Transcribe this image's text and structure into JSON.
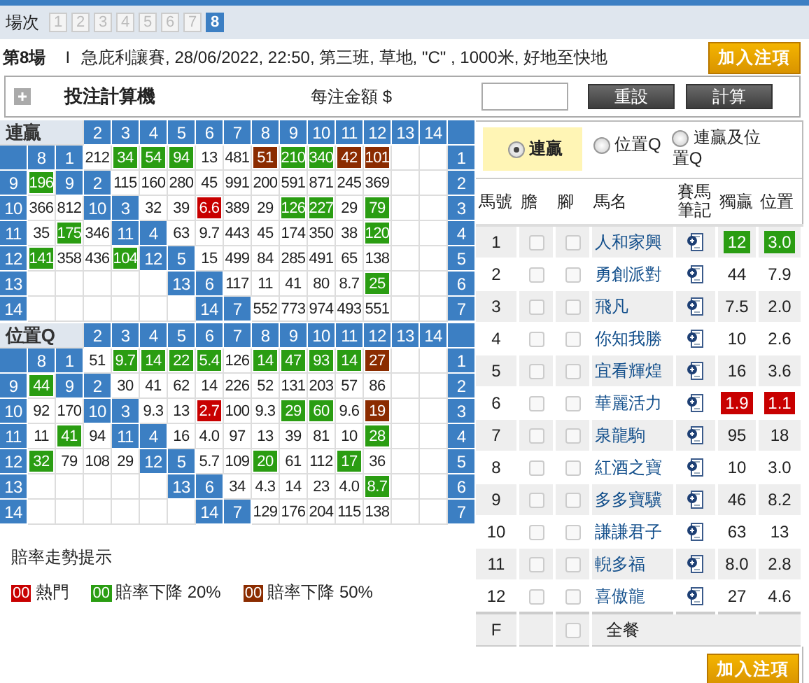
{
  "race_tabs": {
    "label": "場次",
    "items": [
      {
        "label": "1",
        "selected": false
      },
      {
        "label": "2",
        "selected": false
      },
      {
        "label": "3",
        "selected": false
      },
      {
        "label": "4",
        "selected": false
      },
      {
        "label": "5",
        "selected": false
      },
      {
        "label": "6",
        "selected": false
      },
      {
        "label": "7",
        "selected": false
      },
      {
        "label": "8",
        "selected": true
      }
    ]
  },
  "race_info": {
    "number": "第8場",
    "separator": "I",
    "details": "急庇利讓賽, 28/06/2022, 22:50, 第三班, 草地, \"C\" , 1000米, 好地至快地",
    "button": "加入注項"
  },
  "calculator": {
    "title": "投注計算機",
    "expanded": false,
    "amount_label": "每注金額 $",
    "buttons": [
      "重設",
      "計算"
    ]
  },
  "grids": [
    {
      "rows": [
        [
          {
            "text": "連贏",
            "kind": "title"
          },
          {
            "kind": "title"
          },
          {
            "kind": "title"
          },
          {
            "text": "2",
            "kind": "head"
          },
          {
            "text": "3",
            "kind": "head"
          },
          {
            "text": "4",
            "kind": "head"
          },
          {
            "text": "5",
            "kind": "head"
          },
          {
            "text": "6",
            "kind": "head"
          },
          {
            "text": "7",
            "kind": "head"
          },
          {
            "text": "8",
            "kind": "head"
          },
          {
            "text": "9",
            "kind": "head"
          },
          {
            "text": "10",
            "kind": "head"
          },
          {
            "text": "11",
            "kind": "head"
          },
          {
            "text": "12",
            "kind": "head"
          },
          {
            "text": "13",
            "kind": "head"
          },
          {
            "text": "14",
            "kind": "head"
          },
          {
            "kind": "head"
          }
        ],
        [
          {
            "kind": "head"
          },
          {
            "text": "8",
            "kind": "head"
          },
          {
            "text": "1",
            "kind": "head"
          },
          {
            "text": "212",
            "kind": "odds"
          },
          {
            "text": "34",
            "kind": "drop20"
          },
          {
            "text": "54",
            "kind": "drop20"
          },
          {
            "text": "94",
            "kind": "drop20"
          },
          {
            "text": "13",
            "kind": "odds"
          },
          {
            "text": "481",
            "kind": "odds"
          },
          {
            "text": "51",
            "kind": "drop50"
          },
          {
            "text": "210",
            "kind": "drop20"
          },
          {
            "text": "340",
            "kind": "drop20"
          },
          {
            "text": "42",
            "kind": "drop50"
          },
          {
            "text": "101",
            "kind": "drop50"
          },
          {
            "kind": "empty"
          },
          {
            "kind": "empty"
          },
          {
            "text": "1",
            "kind": "head"
          }
        ],
        [
          {
            "text": "9",
            "kind": "head"
          },
          {
            "text": "196",
            "kind": "drop20"
          },
          {
            "text": "9",
            "kind": "head"
          },
          {
            "text": "2",
            "kind": "head"
          },
          {
            "text": "115",
            "kind": "odds"
          },
          {
            "text": "160",
            "kind": "odds"
          },
          {
            "text": "280",
            "kind": "odds"
          },
          {
            "text": "45",
            "kind": "odds"
          },
          {
            "text": "991",
            "kind": "odds"
          },
          {
            "text": "200",
            "kind": "odds"
          },
          {
            "text": "591",
            "kind": "odds"
          },
          {
            "text": "871",
            "kind": "odds"
          },
          {
            "text": "245",
            "kind": "odds"
          },
          {
            "text": "369",
            "kind": "odds"
          },
          {
            "kind": "empty"
          },
          {
            "kind": "empty"
          },
          {
            "text": "2",
            "kind": "head"
          }
        ],
        [
          {
            "text": "10",
            "kind": "head"
          },
          {
            "text": "366",
            "kind": "odds"
          },
          {
            "text": "812",
            "kind": "odds"
          },
          {
            "text": "10",
            "kind": "head"
          },
          {
            "text": "3",
            "kind": "head"
          },
          {
            "text": "32",
            "kind": "odds"
          },
          {
            "text": "39",
            "kind": "odds"
          },
          {
            "text": "6.6",
            "kind": "hot"
          },
          {
            "text": "389",
            "kind": "odds"
          },
          {
            "text": "29",
            "kind": "odds"
          },
          {
            "text": "126",
            "kind": "drop20"
          },
          {
            "text": "227",
            "kind": "drop20"
          },
          {
            "text": "29",
            "kind": "odds"
          },
          {
            "text": "79",
            "kind": "drop20"
          },
          {
            "kind": "empty"
          },
          {
            "kind": "empty"
          },
          {
            "text": "3",
            "kind": "head"
          }
        ],
        [
          {
            "text": "11",
            "kind": "head"
          },
          {
            "text": "35",
            "kind": "odds"
          },
          {
            "text": "175",
            "kind": "drop20"
          },
          {
            "text": "346",
            "kind": "odds"
          },
          {
            "text": "11",
            "kind": "head"
          },
          {
            "text": "4",
            "kind": "head"
          },
          {
            "text": "63",
            "kind": "odds"
          },
          {
            "text": "9.7",
            "kind": "odds"
          },
          {
            "text": "443",
            "kind": "odds"
          },
          {
            "text": "45",
            "kind": "odds"
          },
          {
            "text": "174",
            "kind": "odds"
          },
          {
            "text": "350",
            "kind": "odds"
          },
          {
            "text": "38",
            "kind": "odds"
          },
          {
            "text": "120",
            "kind": "drop20"
          },
          {
            "kind": "empty"
          },
          {
            "kind": "empty"
          },
          {
            "text": "4",
            "kind": "head"
          }
        ],
        [
          {
            "text": "12",
            "kind": "head"
          },
          {
            "text": "141",
            "kind": "drop20"
          },
          {
            "text": "358",
            "kind": "odds"
          },
          {
            "text": "436",
            "kind": "odds"
          },
          {
            "text": "104",
            "kind": "drop20"
          },
          {
            "text": "12",
            "kind": "head"
          },
          {
            "text": "5",
            "kind": "head"
          },
          {
            "text": "15",
            "kind": "odds"
          },
          {
            "text": "499",
            "kind": "odds"
          },
          {
            "text": "84",
            "kind": "odds"
          },
          {
            "text": "285",
            "kind": "odds"
          },
          {
            "text": "491",
            "kind": "odds"
          },
          {
            "text": "65",
            "kind": "odds"
          },
          {
            "text": "138",
            "kind": "odds"
          },
          {
            "kind": "empty"
          },
          {
            "kind": "empty"
          },
          {
            "text": "5",
            "kind": "head"
          }
        ],
        [
          {
            "text": "13",
            "kind": "head"
          },
          {
            "kind": "empty"
          },
          {
            "kind": "empty"
          },
          {
            "kind": "empty"
          },
          {
            "kind": "empty"
          },
          {
            "kind": "empty"
          },
          {
            "text": "13",
            "kind": "head"
          },
          {
            "text": "6",
            "kind": "head"
          },
          {
            "text": "117",
            "kind": "odds"
          },
          {
            "text": "11",
            "kind": "odds"
          },
          {
            "text": "41",
            "kind": "odds"
          },
          {
            "text": "80",
            "kind": "odds"
          },
          {
            "text": "8.7",
            "kind": "odds"
          },
          {
            "text": "25",
            "kind": "drop20"
          },
          {
            "kind": "empty"
          },
          {
            "kind": "empty"
          },
          {
            "text": "6",
            "kind": "head"
          }
        ],
        [
          {
            "text": "14",
            "kind": "head"
          },
          {
            "kind": "empty"
          },
          {
            "kind": "empty"
          },
          {
            "kind": "empty"
          },
          {
            "kind": "empty"
          },
          {
            "kind": "empty"
          },
          {
            "kind": "empty"
          },
          {
            "text": "14",
            "kind": "head"
          },
          {
            "text": "7",
            "kind": "head"
          },
          {
            "text": "552",
            "kind": "odds"
          },
          {
            "text": "773",
            "kind": "odds"
          },
          {
            "text": "974",
            "kind": "odds"
          },
          {
            "text": "493",
            "kind": "odds"
          },
          {
            "text": "551",
            "kind": "odds"
          },
          {
            "kind": "empty"
          },
          {
            "kind": "empty"
          },
          {
            "text": "7",
            "kind": "head"
          }
        ]
      ]
    },
    {
      "rows": [
        [
          {
            "text": "位置Q",
            "kind": "title"
          },
          {
            "kind": "title"
          },
          {
            "kind": "title"
          },
          {
            "text": "2",
            "kind": "head"
          },
          {
            "text": "3",
            "kind": "head"
          },
          {
            "text": "4",
            "kind": "head"
          },
          {
            "text": "5",
            "kind": "head"
          },
          {
            "text": "6",
            "kind": "head"
          },
          {
            "text": "7",
            "kind": "head"
          },
          {
            "text": "8",
            "kind": "head"
          },
          {
            "text": "9",
            "kind": "head"
          },
          {
            "text": "10",
            "kind": "head"
          },
          {
            "text": "11",
            "kind": "head"
          },
          {
            "text": "12",
            "kind": "head"
          },
          {
            "text": "13",
            "kind": "head"
          },
          {
            "text": "14",
            "kind": "head"
          },
          {
            "kind": "head"
          }
        ],
        [
          {
            "kind": "head"
          },
          {
            "text": "8",
            "kind": "head"
          },
          {
            "text": "1",
            "kind": "head"
          },
          {
            "text": "51",
            "kind": "odds"
          },
          {
            "text": "9.7",
            "kind": "drop20"
          },
          {
            "text": "14",
            "kind": "drop20"
          },
          {
            "text": "22",
            "kind": "drop20"
          },
          {
            "text": "5.4",
            "kind": "drop20"
          },
          {
            "text": "126",
            "kind": "odds"
          },
          {
            "text": "14",
            "kind": "drop20"
          },
          {
            "text": "47",
            "kind": "drop20"
          },
          {
            "text": "93",
            "kind": "drop20"
          },
          {
            "text": "14",
            "kind": "drop20"
          },
          {
            "text": "27",
            "kind": "drop50"
          },
          {
            "kind": "empty"
          },
          {
            "kind": "empty"
          },
          {
            "text": "1",
            "kind": "head"
          }
        ],
        [
          {
            "text": "9",
            "kind": "head"
          },
          {
            "text": "44",
            "kind": "drop20"
          },
          {
            "text": "9",
            "kind": "head"
          },
          {
            "text": "2",
            "kind": "head"
          },
          {
            "text": "30",
            "kind": "odds"
          },
          {
            "text": "41",
            "kind": "odds"
          },
          {
            "text": "62",
            "kind": "odds"
          },
          {
            "text": "14",
            "kind": "odds"
          },
          {
            "text": "226",
            "kind": "odds"
          },
          {
            "text": "52",
            "kind": "odds"
          },
          {
            "text": "131",
            "kind": "odds"
          },
          {
            "text": "203",
            "kind": "odds"
          },
          {
            "text": "57",
            "kind": "odds"
          },
          {
            "text": "86",
            "kind": "odds"
          },
          {
            "kind": "empty"
          },
          {
            "kind": "empty"
          },
          {
            "text": "2",
            "kind": "head"
          }
        ],
        [
          {
            "text": "10",
            "kind": "head"
          },
          {
            "text": "92",
            "kind": "odds"
          },
          {
            "text": "170",
            "kind": "odds"
          },
          {
            "text": "10",
            "kind": "head"
          },
          {
            "text": "3",
            "kind": "head"
          },
          {
            "text": "9.3",
            "kind": "odds"
          },
          {
            "text": "13",
            "kind": "odds"
          },
          {
            "text": "2.7",
            "kind": "hot"
          },
          {
            "text": "100",
            "kind": "odds"
          },
          {
            "text": "9.3",
            "kind": "odds"
          },
          {
            "text": "29",
            "kind": "drop20"
          },
          {
            "text": "60",
            "kind": "drop20"
          },
          {
            "text": "9.6",
            "kind": "odds"
          },
          {
            "text": "19",
            "kind": "drop50"
          },
          {
            "kind": "empty"
          },
          {
            "kind": "empty"
          },
          {
            "text": "3",
            "kind": "head"
          }
        ],
        [
          {
            "text": "11",
            "kind": "head"
          },
          {
            "text": "11",
            "kind": "odds"
          },
          {
            "text": "41",
            "kind": "drop20"
          },
          {
            "text": "94",
            "kind": "odds"
          },
          {
            "text": "11",
            "kind": "head"
          },
          {
            "text": "4",
            "kind": "head"
          },
          {
            "text": "16",
            "kind": "odds"
          },
          {
            "text": "4.0",
            "kind": "odds"
          },
          {
            "text": "97",
            "kind": "odds"
          },
          {
            "text": "13",
            "kind": "odds"
          },
          {
            "text": "39",
            "kind": "odds"
          },
          {
            "text": "81",
            "kind": "odds"
          },
          {
            "text": "10",
            "kind": "odds"
          },
          {
            "text": "28",
            "kind": "drop20"
          },
          {
            "kind": "empty"
          },
          {
            "kind": "empty"
          },
          {
            "text": "4",
            "kind": "head"
          }
        ],
        [
          {
            "text": "12",
            "kind": "head"
          },
          {
            "text": "32",
            "kind": "drop20"
          },
          {
            "text": "79",
            "kind": "odds"
          },
          {
            "text": "108",
            "kind": "odds"
          },
          {
            "text": "29",
            "kind": "odds"
          },
          {
            "text": "12",
            "kind": "head"
          },
          {
            "text": "5",
            "kind": "head"
          },
          {
            "text": "5.7",
            "kind": "odds"
          },
          {
            "text": "109",
            "kind": "odds"
          },
          {
            "text": "20",
            "kind": "drop20"
          },
          {
            "text": "61",
            "kind": "odds"
          },
          {
            "text": "112",
            "kind": "odds"
          },
          {
            "text": "17",
            "kind": "drop20"
          },
          {
            "text": "36",
            "kind": "odds"
          },
          {
            "kind": "empty"
          },
          {
            "kind": "empty"
          },
          {
            "text": "5",
            "kind": "head"
          }
        ],
        [
          {
            "text": "13",
            "kind": "head"
          },
          {
            "kind": "empty"
          },
          {
            "kind": "empty"
          },
          {
            "kind": "empty"
          },
          {
            "kind": "empty"
          },
          {
            "kind": "empty"
          },
          {
            "text": "13",
            "kind": "head"
          },
          {
            "text": "6",
            "kind": "head"
          },
          {
            "text": "34",
            "kind": "odds"
          },
          {
            "text": "4.3",
            "kind": "odds"
          },
          {
            "text": "14",
            "kind": "odds"
          },
          {
            "text": "23",
            "kind": "odds"
          },
          {
            "text": "4.0",
            "kind": "odds"
          },
          {
            "text": "8.7",
            "kind": "drop20"
          },
          {
            "kind": "empty"
          },
          {
            "kind": "empty"
          },
          {
            "text": "6",
            "kind": "head"
          }
        ],
        [
          {
            "text": "14",
            "kind": "head"
          },
          {
            "kind": "empty"
          },
          {
            "kind": "empty"
          },
          {
            "kind": "empty"
          },
          {
            "kind": "empty"
          },
          {
            "kind": "empty"
          },
          {
            "kind": "empty"
          },
          {
            "text": "14",
            "kind": "head"
          },
          {
            "text": "7",
            "kind": "head"
          },
          {
            "text": "129",
            "kind": "odds"
          },
          {
            "text": "176",
            "kind": "odds"
          },
          {
            "text": "204",
            "kind": "odds"
          },
          {
            "text": "115",
            "kind": "odds"
          },
          {
            "text": "138",
            "kind": "odds"
          },
          {
            "kind": "empty"
          },
          {
            "kind": "empty"
          },
          {
            "text": "7",
            "kind": "head"
          }
        ]
      ]
    }
  ],
  "legend": {
    "title": "賠率走勢提示",
    "items": [
      {
        "badge": "00",
        "label": "熱門",
        "kind": "hot"
      },
      {
        "badge": "00",
        "label": "賠率下降 20%",
        "kind": "drop20"
      },
      {
        "badge": "00",
        "label": "賠率下降 50%",
        "kind": "drop50"
      }
    ]
  },
  "pool_options": [
    {
      "label": "連贏",
      "selected": true
    },
    {
      "label": "位置Q",
      "selected": false
    },
    {
      "label": "連贏及位置Q",
      "selected": false
    }
  ],
  "horse_table": {
    "columns": [
      "馬號",
      "膽",
      "腳",
      "馬名",
      "賽馬筆記",
      "獨贏",
      "位置"
    ],
    "rows": [
      {
        "no": "1",
        "banker": false,
        "leg": false,
        "name": "人和家興",
        "win": {
          "text": "12",
          "kind": "drop20"
        },
        "place": {
          "text": "3.0",
          "kind": "drop20"
        }
      },
      {
        "no": "2",
        "banker": false,
        "leg": false,
        "name": "勇創派對",
        "win": {
          "text": "44",
          "kind": "odds"
        },
        "place": {
          "text": "7.9",
          "kind": "odds"
        }
      },
      {
        "no": "3",
        "banker": false,
        "leg": false,
        "name": "飛凡",
        "win": {
          "text": "7.5",
          "kind": "odds"
        },
        "place": {
          "text": "2.0",
          "kind": "odds"
        }
      },
      {
        "no": "4",
        "banker": false,
        "leg": false,
        "name": "你知我勝",
        "win": {
          "text": "10",
          "kind": "odds"
        },
        "place": {
          "text": "2.6",
          "kind": "odds"
        }
      },
      {
        "no": "5",
        "banker": false,
        "leg": false,
        "name": "宜看輝煌",
        "win": {
          "text": "16",
          "kind": "odds"
        },
        "place": {
          "text": "3.6",
          "kind": "odds"
        }
      },
      {
        "no": "6",
        "banker": false,
        "leg": false,
        "name": "華麗活力",
        "win": {
          "text": "1.9",
          "kind": "hot"
        },
        "place": {
          "text": "1.1",
          "kind": "hot"
        }
      },
      {
        "no": "7",
        "banker": false,
        "leg": false,
        "name": "泉龍駒",
        "win": {
          "text": "95",
          "kind": "odds"
        },
        "place": {
          "text": "18",
          "kind": "odds"
        }
      },
      {
        "no": "8",
        "banker": false,
        "leg": false,
        "name": "紅酒之寶",
        "win": {
          "text": "10",
          "kind": "odds"
        },
        "place": {
          "text": "3.0",
          "kind": "odds"
        }
      },
      {
        "no": "9",
        "banker": false,
        "leg": false,
        "name": "多多寶驥",
        "win": {
          "text": "46",
          "kind": "odds"
        },
        "place": {
          "text": "8.2",
          "kind": "odds"
        }
      },
      {
        "no": "10",
        "banker": false,
        "leg": false,
        "name": "謙謙君子",
        "win": {
          "text": "63",
          "kind": "odds"
        },
        "place": {
          "text": "13",
          "kind": "odds"
        }
      },
      {
        "no": "11",
        "banker": false,
        "leg": false,
        "name": "輗多福",
        "win": {
          "text": "8.0",
          "kind": "odds"
        },
        "place": {
          "text": "2.8",
          "kind": "odds"
        }
      },
      {
        "no": "12",
        "banker": false,
        "leg": false,
        "name": "喜傲龍",
        "win": {
          "text": "27",
          "kind": "odds"
        },
        "place": {
          "text": "4.6",
          "kind": "odds"
        }
      }
    ],
    "field_row": {
      "no": "F",
      "checked": false,
      "label": "全餐"
    }
  },
  "add_button": "加入注項"
}
